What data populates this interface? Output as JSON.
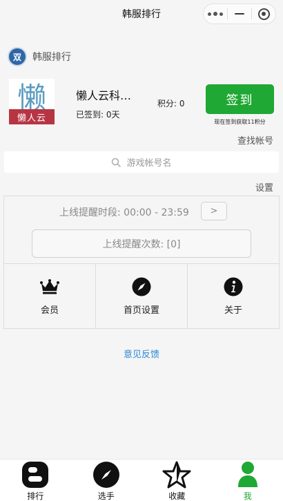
{
  "window": {
    "title": "韩服排行"
  },
  "app": {
    "name": "韩服排行",
    "logo_text": "双"
  },
  "profile": {
    "avatar_char": "懒",
    "avatar_sub": "懒人云",
    "nickname": "懒人云科…",
    "signed_days": "已签到: 0天",
    "points": "积分: 0"
  },
  "sign": {
    "button_label": "签到",
    "hint": "现在签到获取11积分"
  },
  "find_account_link": "查找帐号",
  "search": {
    "placeholder": "游戏帐号名"
  },
  "settings": {
    "label": "设置",
    "period": "上线提醒时段: 00:00 - 23:59",
    "arrow_label": ">",
    "count": "上线提醒次数: [0]"
  },
  "grid": [
    {
      "label": "会员",
      "icon": "crown-icon"
    },
    {
      "label": "首页设置",
      "icon": "compass-icon"
    },
    {
      "label": "关于",
      "icon": "info-icon"
    }
  ],
  "feedback_link": "意见反馈",
  "tabbar": [
    {
      "label": "排行",
      "icon": "blogger-icon",
      "active": false
    },
    {
      "label": "选手",
      "icon": "compass-icon",
      "active": false
    },
    {
      "label": "收藏",
      "icon": "star-icon",
      "active": false
    },
    {
      "label": "我",
      "icon": "user-icon",
      "active": true
    }
  ],
  "colors": {
    "accent_green": "#1fa833",
    "link_blue": "#2b86d6",
    "background": "#f5f5f5"
  }
}
